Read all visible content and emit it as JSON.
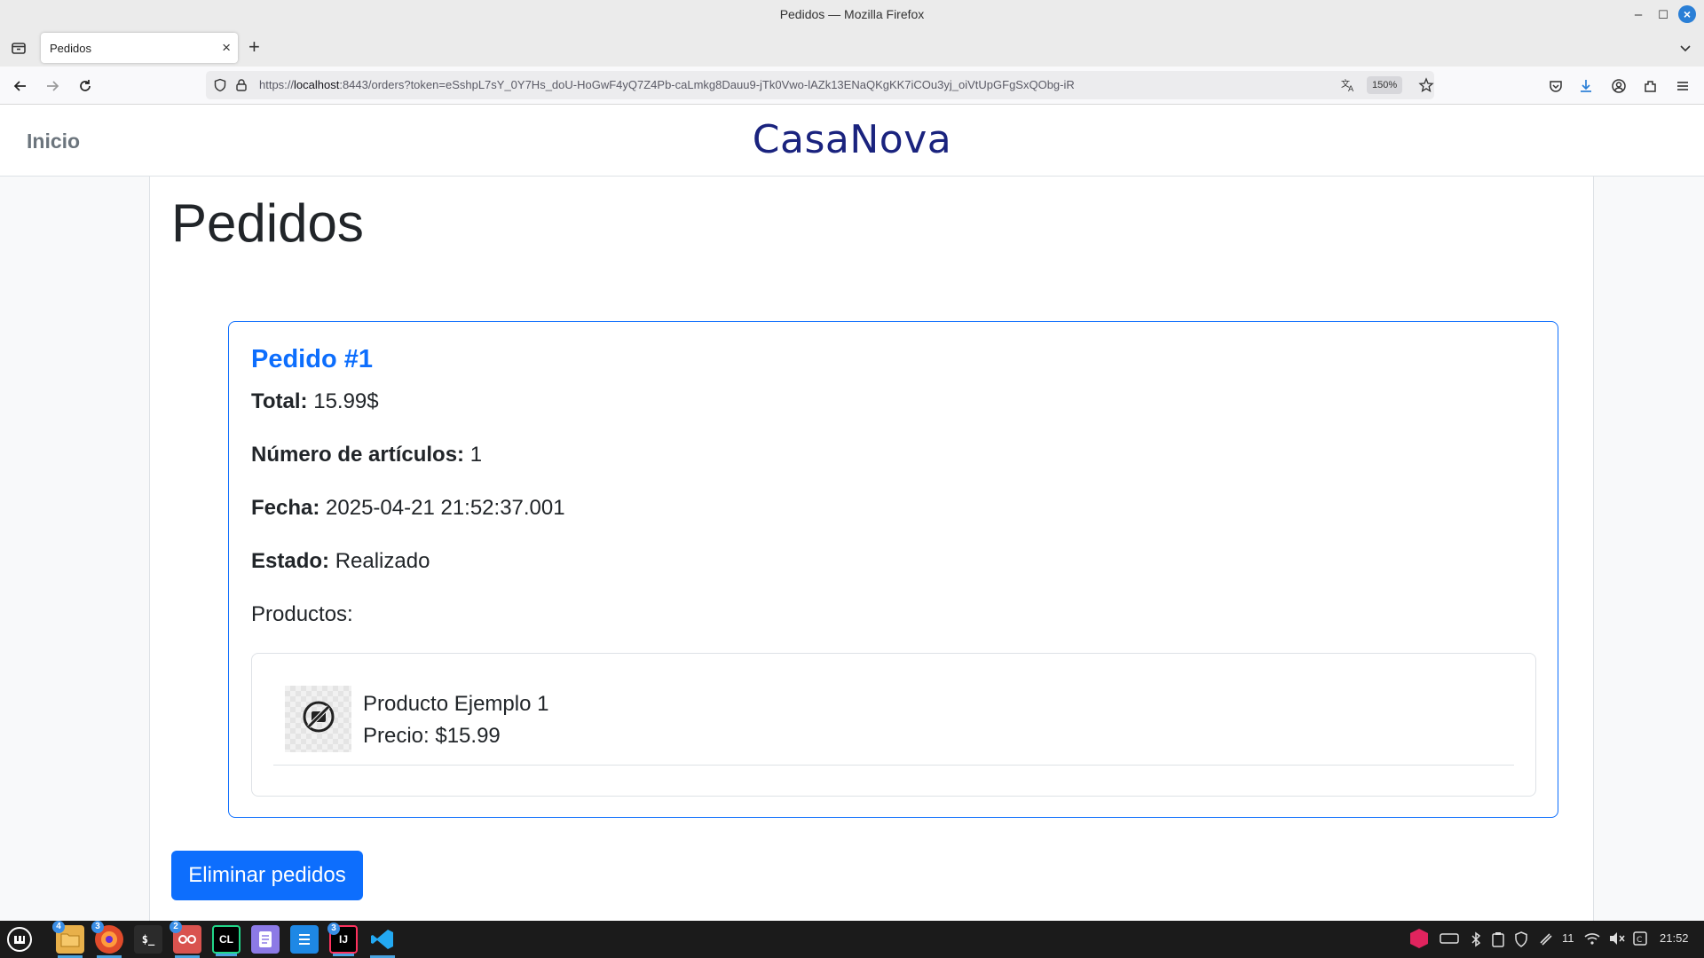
{
  "window": {
    "title": "Pedidos — Mozilla Firefox"
  },
  "browser": {
    "tab_title": "Pedidos",
    "url_prefix": "https://",
    "url_host": "localhost",
    "url_rest": ":8443/orders?token=eSshpL7sY_0Y7Hs_doU-HoGwF4yQ7Z4Pb-caLmkg8Dauu9-jTk0Vwo-lAZk13ENaQKgKK7iCOu3yj_oiVtUpGFgSxQObg-iR",
    "zoom": "150%"
  },
  "site": {
    "home_link": "Inicio",
    "brand": "CasaNova"
  },
  "page": {
    "title": "Pedidos",
    "delete_button": "Eliminar pedidos"
  },
  "order": {
    "title": "Pedido #1",
    "total_label": "Total:",
    "total_value": "15.99$",
    "items_label": "Número de artículos:",
    "items_value": "1",
    "date_label": "Fecha:",
    "date_value": "2025-04-21 21:52:37.001",
    "status_label": "Estado:",
    "status_value": "Realizado",
    "products_label": "Productos:",
    "products": [
      {
        "name": "Producto Ejemplo 1",
        "price": "Precio: $15.99"
      }
    ]
  },
  "taskbar": {
    "badges": {
      "files": "4",
      "firefox": "3",
      "gitkraken": "2",
      "intellij": "3"
    },
    "tray_count": "11",
    "clock": "21:52"
  },
  "colors": {
    "accent": "#0d6efd",
    "brand": "#1a237e"
  }
}
